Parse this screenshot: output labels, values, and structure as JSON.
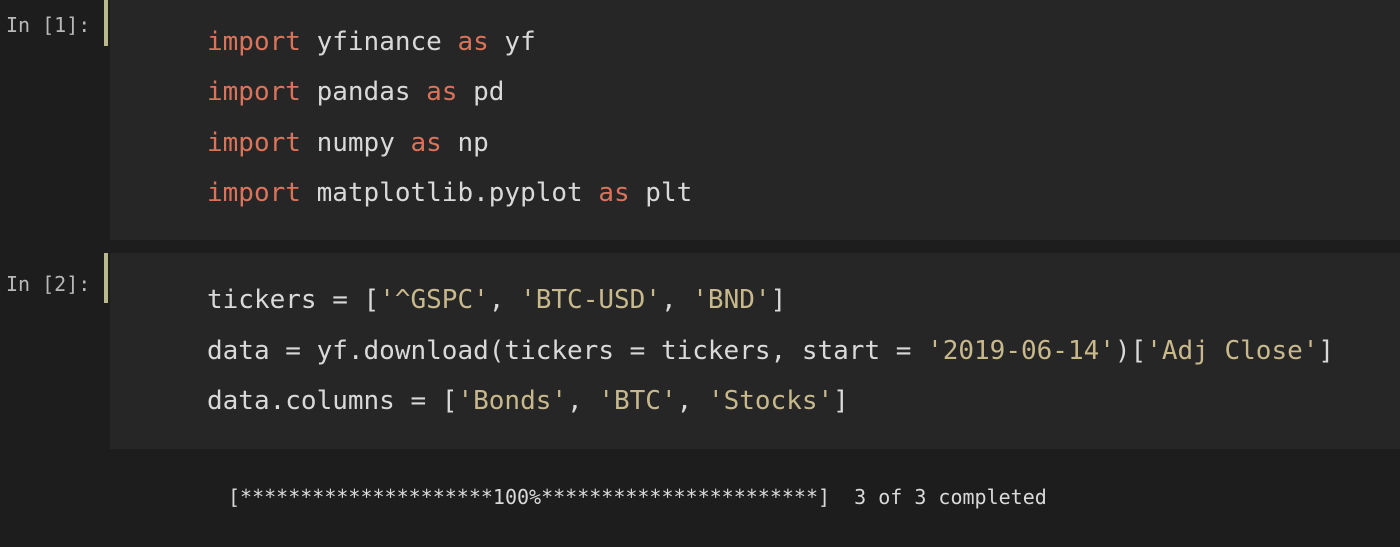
{
  "cells": [
    {
      "prompt": "In [1]:",
      "lines": [
        [
          {
            "t": "import",
            "c": "kw"
          },
          {
            "t": " yfinance ",
            "c": ""
          },
          {
            "t": "as",
            "c": "kw"
          },
          {
            "t": " yf",
            "c": ""
          }
        ],
        [
          {
            "t": "import",
            "c": "kw"
          },
          {
            "t": " pandas ",
            "c": ""
          },
          {
            "t": "as",
            "c": "kw"
          },
          {
            "t": " pd",
            "c": ""
          }
        ],
        [
          {
            "t": "import",
            "c": "kw"
          },
          {
            "t": " numpy ",
            "c": ""
          },
          {
            "t": "as",
            "c": "kw"
          },
          {
            "t": " np",
            "c": ""
          }
        ],
        [
          {
            "t": "import",
            "c": "kw"
          },
          {
            "t": " matplotlib.pyplot ",
            "c": ""
          },
          {
            "t": "as",
            "c": "kw"
          },
          {
            "t": " plt",
            "c": ""
          }
        ]
      ]
    },
    {
      "prompt": "In [2]:",
      "lines": [
        [
          {
            "t": "tickers = [",
            "c": ""
          },
          {
            "t": "'^GSPC'",
            "c": "str"
          },
          {
            "t": ", ",
            "c": ""
          },
          {
            "t": "'BTC-USD'",
            "c": "str"
          },
          {
            "t": ", ",
            "c": ""
          },
          {
            "t": "'BND'",
            "c": "str"
          },
          {
            "t": "]",
            "c": ""
          }
        ],
        [
          {
            "t": "data = yf.download(tickers = tickers, start = ",
            "c": ""
          },
          {
            "t": "'2019-06-14'",
            "c": "str"
          },
          {
            "t": ")[",
            "c": ""
          },
          {
            "t": "'Adj Close'",
            "c": "str"
          },
          {
            "t": "]",
            "c": ""
          }
        ],
        [
          {
            "t": "data.columns = [",
            "c": ""
          },
          {
            "t": "'Bonds'",
            "c": "str"
          },
          {
            "t": ", ",
            "c": ""
          },
          {
            "t": "'BTC'",
            "c": "str"
          },
          {
            "t": ", ",
            "c": ""
          },
          {
            "t": "'Stocks'",
            "c": "str"
          },
          {
            "t": "]",
            "c": ""
          }
        ]
      ]
    }
  ],
  "output": {
    "progress_text": "[*********************100%***********************]  3 of 3 completed"
  },
  "colors": {
    "keyword": "#d9745a",
    "string": "#c8b98c",
    "text": "#d9d9d9",
    "prompt": "#b8b8b8",
    "cell_edge": "#b9b98c"
  }
}
